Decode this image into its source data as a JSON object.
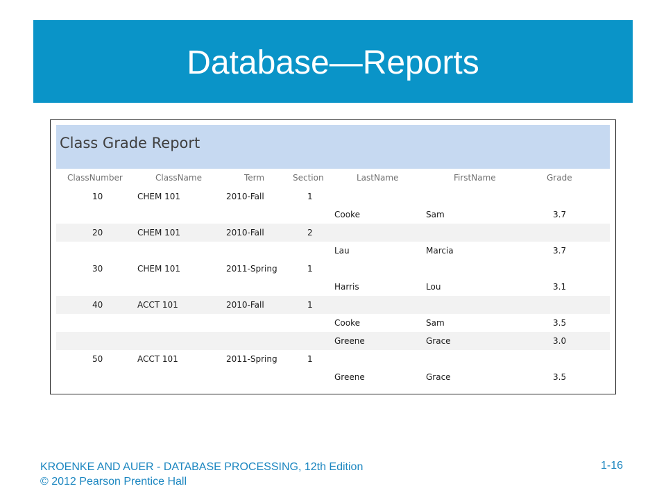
{
  "slide": {
    "title": "Database—Reports"
  },
  "report": {
    "title": "Class Grade Report",
    "columns": [
      "ClassNumber",
      "ClassName",
      "Term",
      "Section",
      "LastName",
      "FirstName",
      "Grade"
    ],
    "rows": [
      {
        "class_number": "10",
        "class_name": "CHEM 101",
        "term": "2010-Fall",
        "section": "1",
        "last_name": "",
        "first_name": "",
        "grade": ""
      },
      {
        "class_number": "",
        "class_name": "",
        "term": "",
        "section": "",
        "last_name": "Cooke",
        "first_name": "Sam",
        "grade": "3.7"
      },
      {
        "class_number": "20",
        "class_name": "CHEM 101",
        "term": "2010-Fall",
        "section": "2",
        "last_name": "",
        "first_name": "",
        "grade": ""
      },
      {
        "class_number": "",
        "class_name": "",
        "term": "",
        "section": "",
        "last_name": "Lau",
        "first_name": "Marcia",
        "grade": "3.7"
      },
      {
        "class_number": "30",
        "class_name": "CHEM 101",
        "term": "2011-Spring",
        "section": "1",
        "last_name": "",
        "first_name": "",
        "grade": ""
      },
      {
        "class_number": "",
        "class_name": "",
        "term": "",
        "section": "",
        "last_name": "Harris",
        "first_name": "Lou",
        "grade": "3.1"
      },
      {
        "class_number": "40",
        "class_name": "ACCT 101",
        "term": "2010-Fall",
        "section": "1",
        "last_name": "",
        "first_name": "",
        "grade": ""
      },
      {
        "class_number": "",
        "class_name": "",
        "term": "",
        "section": "",
        "last_name": "Cooke",
        "first_name": "Sam",
        "grade": "3.5"
      },
      {
        "class_number": "",
        "class_name": "",
        "term": "",
        "section": "",
        "last_name": "Greene",
        "first_name": "Grace",
        "grade": "3.0"
      },
      {
        "class_number": "50",
        "class_name": "ACCT 101",
        "term": "2011-Spring",
        "section": "1",
        "last_name": "",
        "first_name": "",
        "grade": ""
      },
      {
        "class_number": "",
        "class_name": "",
        "term": "",
        "section": "",
        "last_name": "Greene",
        "first_name": "Grace",
        "grade": "3.5"
      }
    ]
  },
  "footer": {
    "line1": "KROENKE AND AUER - DATABASE PROCESSING, 12th Edition",
    "line2": "© 2012 Pearson Prentice Hall",
    "page_number": "1-16"
  },
  "colors": {
    "title_bar": "#0a94c8",
    "report_header": "#c6d9f1",
    "footer_text": "#1b86c0"
  }
}
